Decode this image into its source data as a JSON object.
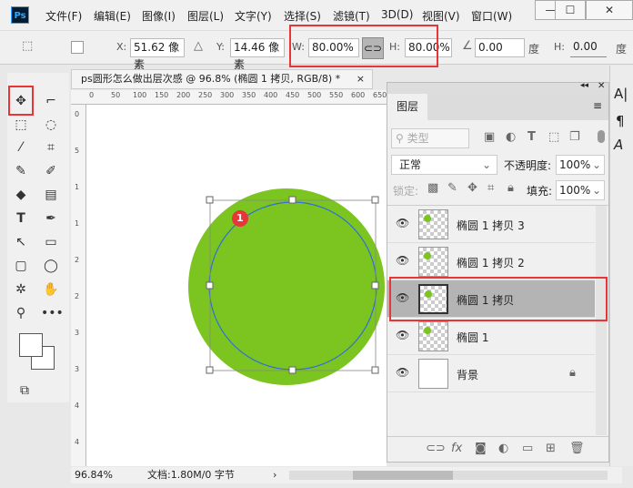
{
  "app": {
    "logo": "Ps"
  },
  "menu": [
    "文件(F)",
    "编辑(E)",
    "图像(I)",
    "图层(L)",
    "文字(Y)",
    "选择(S)",
    "滤镜(T)",
    "3D(D)",
    "视图(V)",
    "窗口(W)"
  ],
  "window_buttons": [
    "—",
    "☐",
    "✕"
  ],
  "options": {
    "x_label": "X:",
    "x_value": "51.62 像素",
    "y_label": "Y:",
    "y_value": "14.46 像素",
    "w_label": "W:",
    "w_value": "80.00%",
    "h_label": "H:",
    "h_value": "80.00%",
    "angle_value": "0.00",
    "angle_unit": "度",
    "hskew_label": "H:",
    "hskew_value": "0.00",
    "hskew_unit": "度"
  },
  "document": {
    "tab_title": "ps圆形怎么做出层次感 @ 96.8% (椭圆 1 拷贝, RGB/8) *",
    "close": "×",
    "ruler_top": [
      "0",
      "50",
      "100",
      "150",
      "200",
      "250",
      "300",
      "350",
      "400",
      "450",
      "500",
      "550",
      "600",
      "650"
    ],
    "ruler_left": [
      "0",
      "5",
      "1",
      "1",
      "2",
      "2",
      "3",
      "3",
      "4",
      "4"
    ],
    "badge": "1",
    "fill_color": "#7cc520"
  },
  "status": {
    "zoom": "96.84%",
    "doc_info": "文档:1.80M/0 字节"
  },
  "layers_panel": {
    "tab": "图层",
    "filter_placeholder": "类型",
    "blend_mode": "正常",
    "opacity_label": "不透明度:",
    "opacity": "100%",
    "lock_label": "锁定:",
    "fill_label": "填充:",
    "fill": "100%",
    "layers": [
      {
        "name": "椭圆 1 拷贝 3",
        "selected": false
      },
      {
        "name": "椭圆 1 拷贝 2",
        "selected": false
      },
      {
        "name": "椭圆 1 拷贝",
        "selected": true
      },
      {
        "name": "椭圆 1",
        "selected": false
      },
      {
        "name": "背景",
        "selected": false,
        "locked": true
      }
    ],
    "bottom_icons": [
      "link-icon",
      "fx-icon",
      "mask-icon",
      "adjustment-icon",
      "group-icon",
      "new-layer-icon",
      "trash-icon"
    ]
  }
}
